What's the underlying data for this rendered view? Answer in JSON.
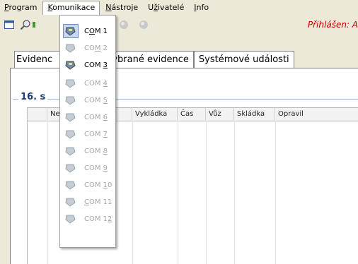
{
  "menubar": {
    "items": [
      {
        "pre": "",
        "acc": "P",
        "post": "rogram"
      },
      {
        "pre": "",
        "acc": "K",
        "post": "omunikace"
      },
      {
        "pre": "",
        "acc": "N",
        "post": "ástroje"
      },
      {
        "pre": "U",
        "acc": "ž",
        "post": "ivatelé"
      },
      {
        "pre": "",
        "acc": "I",
        "post": "nfo"
      }
    ]
  },
  "toolbar": {
    "login_status": "Přihlášen: A"
  },
  "tabs": [
    "Evidenc",
    "l",
    "Vybrané evidence",
    "Systémové události"
  ],
  "group": {
    "title": "16. s"
  },
  "grid": {
    "columns": [
      "Ne",
      "Vykládka",
      "Čas",
      "Vůz",
      "Skládka",
      "Opravil"
    ]
  },
  "dropdown": {
    "items": [
      {
        "pre": "C",
        "acc": "O",
        "post": "M 1",
        "enabled": true,
        "highlight": true
      },
      {
        "pre": "CO",
        "acc": "M",
        "post": " 2",
        "enabled": false,
        "highlight": false
      },
      {
        "pre": "COM ",
        "acc": "3",
        "post": "",
        "enabled": true,
        "highlight": false
      },
      {
        "pre": "COM ",
        "acc": "4",
        "post": "",
        "enabled": false,
        "highlight": false
      },
      {
        "pre": "COM ",
        "acc": "5",
        "post": "",
        "enabled": false,
        "highlight": false
      },
      {
        "pre": "COM ",
        "acc": "6",
        "post": "",
        "enabled": false,
        "highlight": false
      },
      {
        "pre": "COM ",
        "acc": "7",
        "post": "",
        "enabled": false,
        "highlight": false
      },
      {
        "pre": "COM ",
        "acc": "8",
        "post": "",
        "enabled": false,
        "highlight": false
      },
      {
        "pre": "COM ",
        "acc": "9",
        "post": "",
        "enabled": false,
        "highlight": false
      },
      {
        "pre": "COM ",
        "acc": "1",
        "post": "0",
        "enabled": false,
        "highlight": false
      },
      {
        "pre": "",
        "acc": "C",
        "post": "OM 11",
        "enabled": false,
        "highlight": false
      },
      {
        "pre": "COM 1",
        "acc": "2",
        "post": "",
        "enabled": false,
        "highlight": false
      }
    ]
  },
  "colors": {
    "background": "#ece9d8",
    "login_status": "#c00000",
    "group_title": "#1f3b7a",
    "disabled_text": "#a7a7a7"
  }
}
